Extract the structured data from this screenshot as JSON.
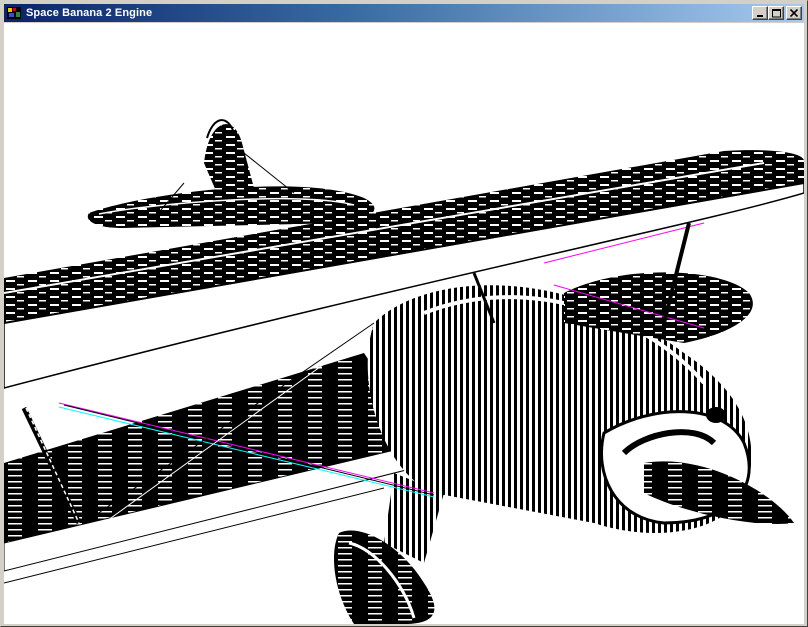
{
  "window": {
    "title": "Space Banana 2 Engine",
    "icon": "app-engine-icon",
    "buttons": {
      "minimize": "minimize-icon",
      "maximize": "maximize-icon",
      "close": "close-icon"
    }
  },
  "viewport": {
    "scene": "biplane-render",
    "background": "#ffffff",
    "foreground": "#000000",
    "accent_colors": [
      "#ff00ff",
      "#00ffff"
    ]
  }
}
